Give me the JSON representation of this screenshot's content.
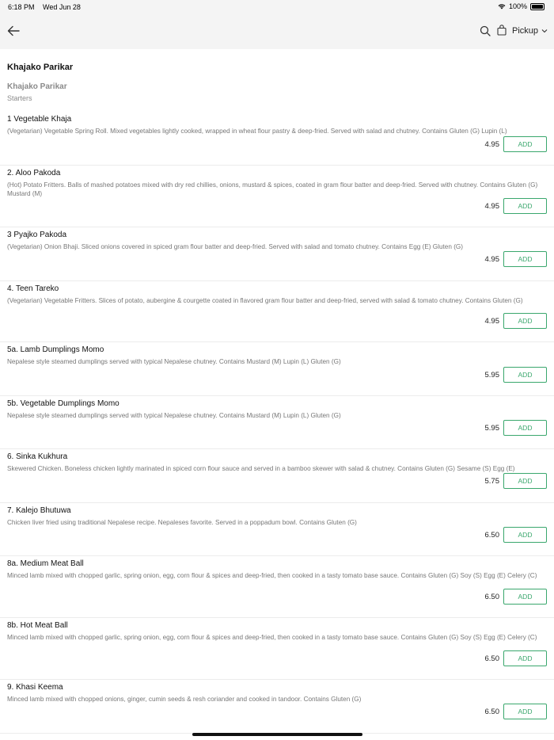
{
  "status": {
    "time": "6:18 PM",
    "date": "Wed Jun 28",
    "battery": "100%"
  },
  "nav": {
    "pickup_label": "Pickup"
  },
  "page": {
    "title": "Khajako Parikar",
    "restaurant": "Khajako Parikar",
    "category": "Starters"
  },
  "items": [
    {
      "name": "1 Vegetable Khaja",
      "desc": "(Vegetarian) Vegetable Spring Roll. Mixed vegetables lightly cooked, wrapped in wheat flour pastry & deep-fried. Served with salad and chutney.   Contains  Gluten (G)  Lupin (L)",
      "price": "4.95",
      "add": "ADD"
    },
    {
      "name": "2. Aloo Pakoda",
      "desc": "(Hot) Potato Fritters. Balls of mashed potatoes mixed with dry red chillies, onions, mustard & spices, coated in gram flour batter and deep-fried. Served with chutney.   Contains  Gluten (G)  Mustard (M)",
      "price": "4.95",
      "add": "ADD"
    },
    {
      "name": "3 Pyajko Pakoda",
      "desc": "(Vegetarian) Onion Bhaji. Sliced onions covered in spiced gram flour batter and deep-fried. Served with salad and tomato chutney.   Contains  Egg (E)  Gluten (G)",
      "price": "4.95",
      "add": "ADD"
    },
    {
      "name": "4. Teen Tareko",
      "desc": "(Vegetarian) Vegetable Fritters. Slices of potato, aubergine & courgette coated in flavored gram flour batter and deep-fried, served with salad & tomato chutney.   Contains  Gluten (G)",
      "price": "4.95",
      "add": "ADD"
    },
    {
      "name": "5a. Lamb Dumplings Momo",
      "desc": "Nepalese style steamed dumplings served with typical Nepalese chutney.   Contains  Mustard (M)  Lupin (L)  Gluten (G)",
      "price": "5.95",
      "add": "ADD"
    },
    {
      "name": "5b. Vegetable Dumplings Momo",
      "desc": "Nepalese style steamed dumplings served with typical Nepalese chutney.   Contains  Mustard (M)  Lupin (L)  Gluten (G)",
      "price": "5.95",
      "add": "ADD"
    },
    {
      "name": "6. Sinka Kukhura",
      "desc": "Skewered Chicken. Boneless chicken lightly marinated in spiced corn flour sauce and served in a bamboo skewer with salad & chutney.   Contains  Gluten (G)  Sesame (S)  Egg (E)",
      "price": "5.75",
      "add": "ADD"
    },
    {
      "name": "7. Kalejo Bhutuwa",
      "desc": "Chicken liver fried using traditional Nepalese recipe. Nepaleses favorite.  Served in a poppadum bowl.   Contains  Gluten (G)",
      "price": "6.50",
      "add": "ADD"
    },
    {
      "name": "8a. Medium Meat Ball",
      "desc": "Minced lamb mixed with chopped garlic, spring onion, egg, corn flour & spices and deep-fried, then cooked in a tasty tomato base sauce.   Contains  Gluten (G)  Soy (S)  Egg (E)  Celery (C)",
      "price": "6.50",
      "add": "ADD"
    },
    {
      "name": "8b. Hot Meat Ball",
      "desc": "Minced lamb mixed with chopped garlic, spring onion, egg, corn flour & spices and deep-fried, then cooked in a tasty tomato base sauce.   Contains  Gluten (G)  Soy (S)  Egg (E)  Celery (C)",
      "price": "6.50",
      "add": "ADD"
    },
    {
      "name": "9. Khasi Keema",
      "desc": "Minced lamb mixed with chopped onions, ginger, cumin seeds & resh coriander and cooked in tandoor.   Contains  Gluten (G)",
      "price": "6.50",
      "add": "ADD"
    }
  ],
  "icons": {
    "back": "arrow-left-icon",
    "search": "search-icon",
    "bag": "shopping-bag-icon",
    "chevron": "chevron-down-icon"
  },
  "colors": {
    "accent": "#3aa76d",
    "header_bg": "#f4f4f4"
  }
}
